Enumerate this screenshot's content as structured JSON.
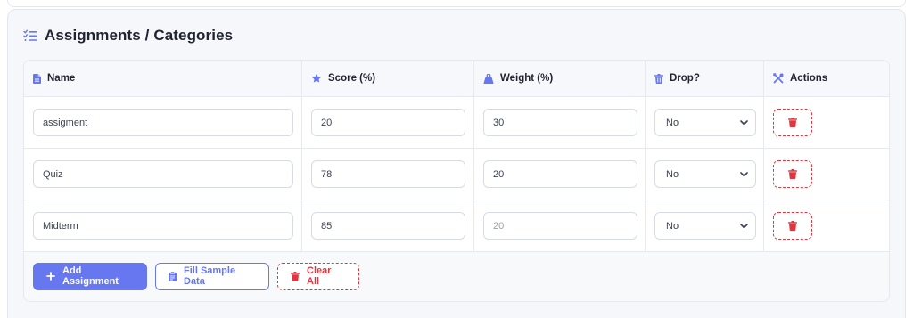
{
  "section": {
    "title": "Assignments / Categories",
    "title_icon": "list-check-icon"
  },
  "colors": {
    "accent": "#6777ef",
    "danger": "#e0363f",
    "panel_bg": "#f5f7fb",
    "text": "#1f2430"
  },
  "table": {
    "headers": [
      {
        "label": "Name",
        "icon": "file-icon"
      },
      {
        "label": "Score (%)",
        "icon": "star-icon"
      },
      {
        "label": "Weight (%)",
        "icon": "weight-icon"
      },
      {
        "label": "Drop?",
        "icon": "trash-icon"
      },
      {
        "label": "Actions",
        "icon": "tools-icon"
      }
    ],
    "rows": [
      {
        "name": "assigment",
        "score": "20",
        "weight": "30",
        "weight_is_placeholder": false,
        "drop": "No"
      },
      {
        "name": "Quiz",
        "score": "78",
        "weight": "20",
        "weight_is_placeholder": false,
        "drop": "No"
      },
      {
        "name": "Midterm",
        "score": "85",
        "weight": "20",
        "weight_is_placeholder": true,
        "drop": "No"
      }
    ]
  },
  "buttons": {
    "add": "Add Assignment",
    "fill": "Fill Sample Data",
    "clear": "Clear All"
  }
}
